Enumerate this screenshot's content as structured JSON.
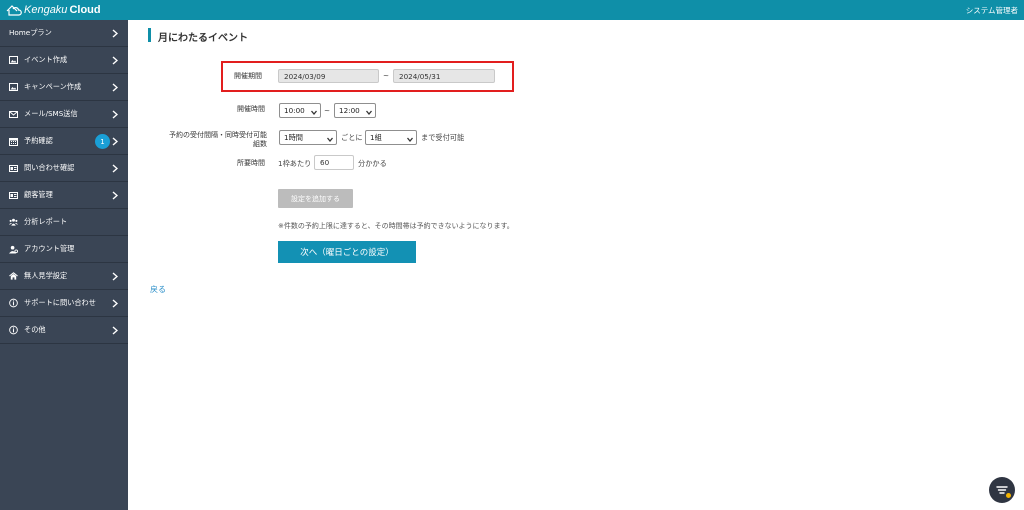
{
  "header": {
    "logo_part1": "Kengaku",
    "logo_part2": "Cloud",
    "user_label": "システム管理者"
  },
  "sidebar": {
    "items": [
      {
        "label": "Homeプラン",
        "icon": "none",
        "chevron": true
      },
      {
        "label": "イベント作成",
        "icon": "image-icon",
        "chevron": true
      },
      {
        "label": "キャンペーン作成",
        "icon": "image-icon",
        "chevron": true
      },
      {
        "label": "メール/SMS送信",
        "icon": "mail-icon",
        "chevron": true
      },
      {
        "label": "予約確認",
        "icon": "calendar-icon",
        "chevron": true,
        "badge": "1"
      },
      {
        "label": "問い合わせ確認",
        "icon": "id-card-icon",
        "chevron": true
      },
      {
        "label": "顧客管理",
        "icon": "id-card-icon",
        "chevron": true
      },
      {
        "label": "分析レポート",
        "icon": "users-icon",
        "chevron": false
      },
      {
        "label": "アカウント管理",
        "icon": "user-gear-icon",
        "chevron": false
      },
      {
        "label": "無人見学設定",
        "icon": "home-icon",
        "chevron": true
      },
      {
        "label": "サポートに問い合わせ",
        "icon": "info-icon",
        "chevron": true
      },
      {
        "label": "その他",
        "icon": "info-icon",
        "chevron": true
      }
    ]
  },
  "main": {
    "title": "月にわたるイベント",
    "period": {
      "label": "開催期間",
      "start": "2024/03/09",
      "separator": "~",
      "end": "2024/05/31"
    },
    "time": {
      "label": "開催時間",
      "start": "10:00",
      "separator": "~",
      "end": "12:00"
    },
    "interval": {
      "label_line1": "予約の受付間隔・同時受付可能",
      "label_line2": "組数",
      "interval_value": "1時間",
      "per_text": "ごとに",
      "groups_value": "1組",
      "suffix_text": "まで受付可能"
    },
    "duration": {
      "label": "所要時間",
      "prefix_text": "1枠あたり",
      "value": "60",
      "suffix_text": "分かかる"
    },
    "add_button": "設定を追加する",
    "note": "※件数の予約上限に達すると、その時間帯は予約できないようになります。",
    "next_button": "次へ（曜日ごとの設定）",
    "back_link": "戻る"
  },
  "colors": {
    "topbar": "#0f8fa8",
    "sidebar": "#3a4555",
    "highlight": "#e21e1e",
    "primary_button": "#1391b4",
    "badge": "#1a9fd6"
  }
}
